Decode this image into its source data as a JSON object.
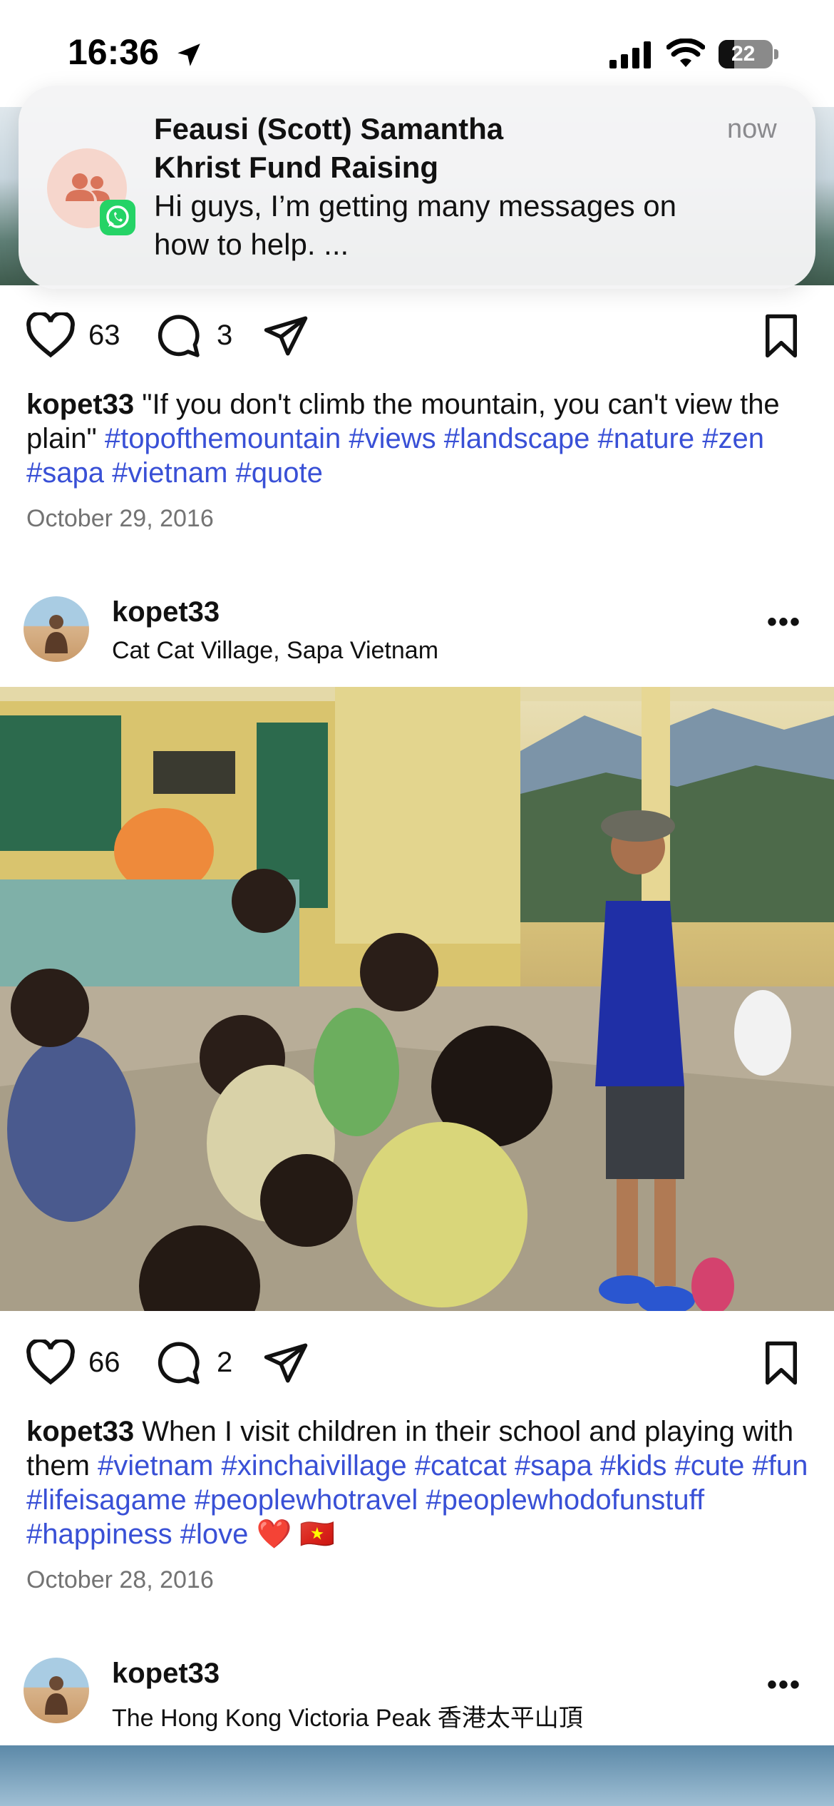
{
  "status_bar": {
    "time": "16:36",
    "battery": "22"
  },
  "notification": {
    "sender": "Feausi (Scott) Samantha",
    "group": "Khrist Fund Raising",
    "body_line1": "Hi guys, I’m getting many messages on",
    "body_line2": "how to help. ...",
    "time": "now",
    "app_icon": "whatsapp-icon"
  },
  "post1": {
    "likes": "63",
    "comments": "3",
    "username": "kopet33",
    "caption_text": " \"If you don't climb the mountain, you can't view the plain\" ",
    "hashtags": [
      "#topofthemountain",
      "#views",
      "#landscape",
      "#nature",
      "#zen",
      "#sapa",
      "#vietnam",
      "#quote"
    ],
    "date": "October 29, 2016"
  },
  "post2": {
    "username": "kopet33",
    "location": "Cat Cat Village, Sapa Vietnam",
    "likes": "66",
    "comments": "2",
    "caption_text": " When I visit children in their school and playing with them ",
    "hashtags": [
      "#vietnam",
      "#xinchaivillage",
      "#catcat",
      "#sapa",
      "#kids",
      "#cute",
      "#fun",
      "#lifeisagame",
      "#peoplewhotravel",
      "#peoplewhodofunstuff",
      "#happiness",
      "#love"
    ],
    "emoji": "❤️ 🇻🇳",
    "date": "October 28, 2016"
  },
  "post3": {
    "username": "kopet33",
    "location": "The Hong Kong Victoria Peak 香港太平山頂"
  },
  "colors": {
    "hashtag": "#3950d6",
    "whatsapp": "#25d366",
    "date_gray": "#737373"
  }
}
